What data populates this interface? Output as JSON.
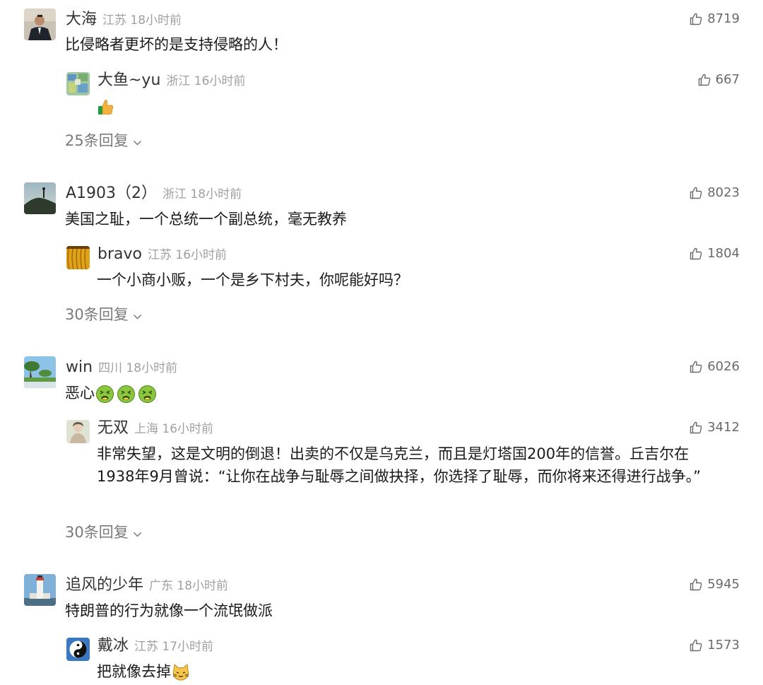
{
  "comments": [
    {
      "name": "大海",
      "meta": "江苏 18小时前",
      "likes": "8719",
      "text": "比侵略者更坏的是支持侵略的人！",
      "reply": {
        "name": "大鱼~yu",
        "meta": "浙江 16小时前",
        "likes": "667",
        "text": ""
      },
      "more": "25条回复"
    },
    {
      "name": "A1903（2）",
      "meta": "浙江 18小时前",
      "likes": "8023",
      "text": "美国之耻，一个总统一个副总统，毫无教养",
      "reply": {
        "name": "bravo",
        "meta": "江苏 16小时前",
        "likes": "1804",
        "text": "一个小商小贩，一个是乡下村夫，你呢能好吗？"
      },
      "more": "30条回复"
    },
    {
      "name": "win",
      "meta": "四川 18小时前",
      "likes": "6026",
      "text": "恶心",
      "reply": {
        "name": "无双",
        "meta": "上海 16小时前",
        "likes": "3412",
        "text": "非常失望，这是文明的倒退！出卖的不仅是乌克兰，而且是灯塔国200年的信誉。丘吉尔在1938年9月曾说：“让你在战争与耻辱之间做抉择，你选择了耻辱，而你将来还得进行战争。”"
      },
      "more": "30条回复"
    },
    {
      "name": "追风的少年",
      "meta": "广东 18小时前",
      "likes": "5945",
      "text": "特朗普的行为就像一个流氓做派",
      "reply": {
        "name": "戴冰",
        "meta": "江苏 17小时前",
        "likes": "1573",
        "text": "把就像去掉"
      }
    }
  ],
  "icons": {
    "like": "thumbs-up-outline-icon",
    "more": "chevron-down-icon",
    "emoji_thumbs_up": "thumbs-up-emoji",
    "emoji_nauseated": "nauseated-face-emoji",
    "emoji_cat": "cat-face-emoji"
  },
  "colors": {
    "username": "#333333",
    "meta": "#a0a0a0",
    "text": "#1a1a1a",
    "count": "#6a6a6a",
    "more": "#7a7a7a"
  }
}
